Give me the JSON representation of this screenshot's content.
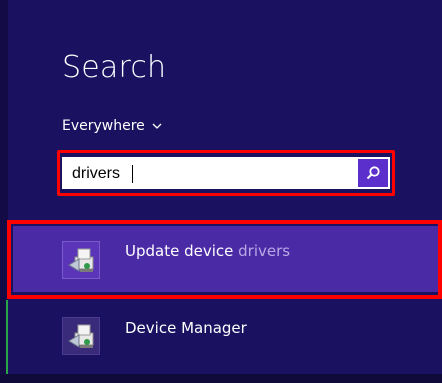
{
  "search_panel": {
    "title": "Search",
    "scope": "Everywhere",
    "query": "drivers"
  },
  "results": [
    {
      "label_main": "Update device",
      "label_highlight": "drivers",
      "icon": "device-manager-icon",
      "selected": true
    },
    {
      "label_main": "Device Manager",
      "label_highlight": "",
      "icon": "device-manager-icon",
      "selected": false
    }
  ],
  "colors": {
    "background": "#1b1161",
    "selected_row": "#4b2aa6",
    "search_button": "#5b2fcc",
    "highlight_box": "#ff0000"
  }
}
